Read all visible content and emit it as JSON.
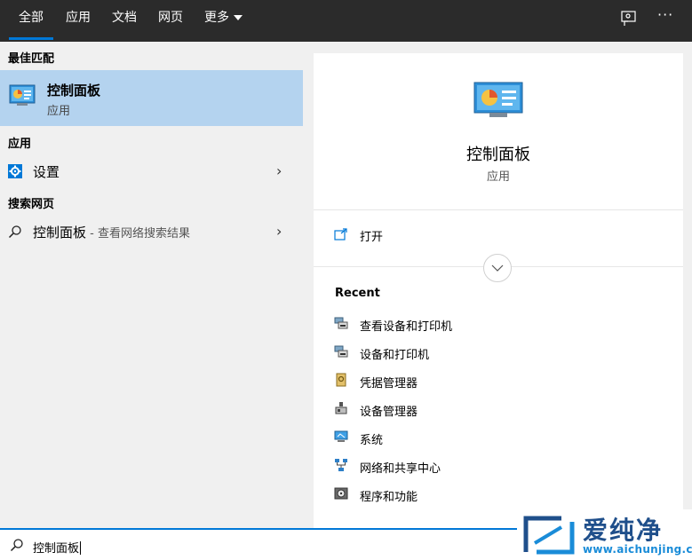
{
  "tabs": [
    {
      "label": "全部",
      "active": true
    },
    {
      "label": "应用"
    },
    {
      "label": "文档"
    },
    {
      "label": "网页"
    },
    {
      "label": "更多"
    }
  ],
  "topbar_icons": [
    "feedback-icon",
    "more-options-icon"
  ],
  "more_dots": "···",
  "left": {
    "best_match_header": "最佳匹配",
    "best_match": {
      "name": "控制面板",
      "type": "应用",
      "icon": "control-panel-icon"
    },
    "apps_header": "应用",
    "apps": [
      {
        "label": "设置",
        "icon": "gear-icon"
      }
    ],
    "web_header": "搜索网页",
    "web": [
      {
        "label": "控制面板",
        "hint": " - 查看网络搜索结果",
        "icon": "search-icon"
      }
    ]
  },
  "right": {
    "title": "控制面板",
    "subtitle": "应用",
    "open_label": "打开",
    "recent_header": "Recent",
    "recent": [
      {
        "label": "查看设备和打印机",
        "icon": "devices-printers-icon"
      },
      {
        "label": "设备和打印机",
        "icon": "devices-printers-icon"
      },
      {
        "label": "凭据管理器",
        "icon": "credential-manager-icon"
      },
      {
        "label": "设备管理器",
        "icon": "device-manager-icon"
      },
      {
        "label": "系统",
        "icon": "system-icon"
      },
      {
        "label": "网络和共享中心",
        "icon": "network-icon"
      },
      {
        "label": "程序和功能",
        "icon": "programs-icon"
      }
    ]
  },
  "search": {
    "value": "控制面板"
  },
  "watermark": {
    "text": "爱纯净",
    "url": "www.aichunjing.com"
  },
  "colors": {
    "accent": "#0078d7",
    "selected": "#b4d3ef",
    "topbar": "#2b2b2b"
  }
}
